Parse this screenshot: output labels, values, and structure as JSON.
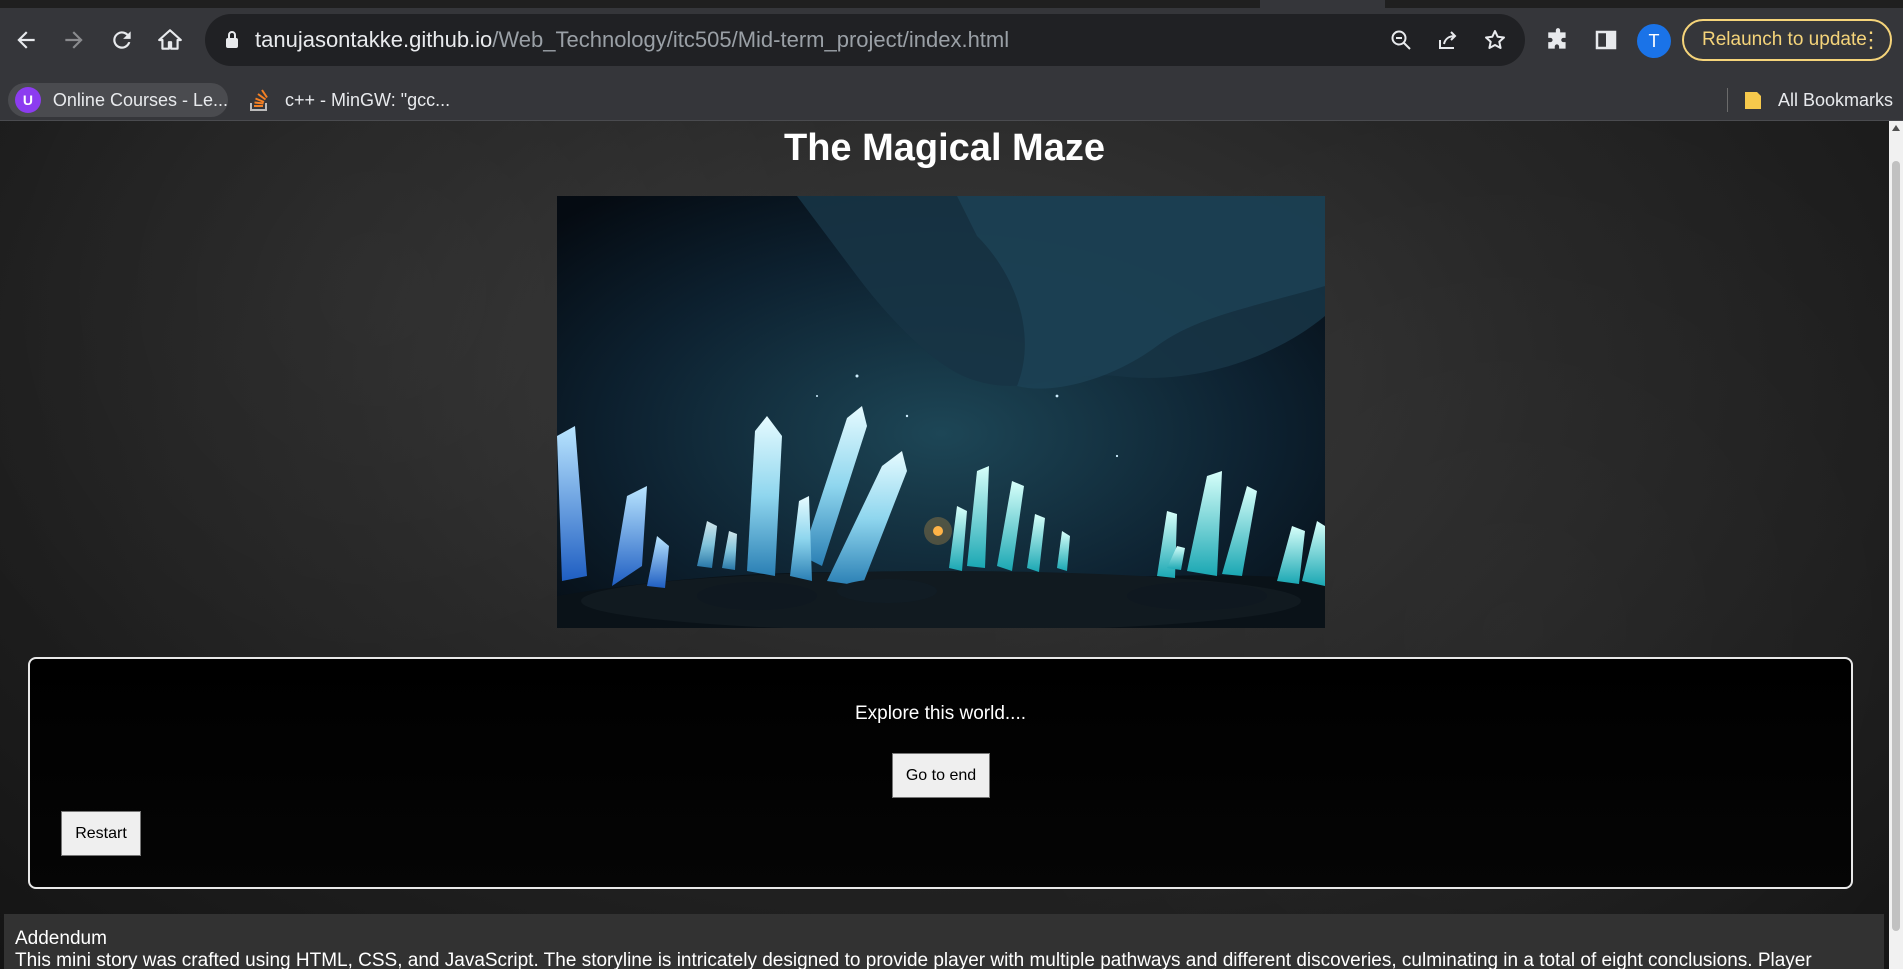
{
  "browser": {
    "url_host": "tanujasontakke.github.io",
    "url_path": "/Web_Technology/itc505/Mid-term_project/index.html",
    "avatar_letter": "T",
    "relaunch_label": "Relaunch to update",
    "icons": [
      "back-icon",
      "forward-icon",
      "reload-icon",
      "home-icon",
      "lock-icon",
      "zoom-icon",
      "share-icon",
      "star-icon",
      "extensions-icon",
      "side-panel-icon",
      "more-icon"
    ]
  },
  "bookmarks": {
    "items": [
      {
        "label": "Online Courses - Le...",
        "icon_color": "#8c3cf0"
      },
      {
        "label": "c++ - MinGW: \"gcc...",
        "icon_color": "#f48024"
      }
    ],
    "all_bookmarks_label": "All Bookmarks"
  },
  "page": {
    "title": "The Magical Maze",
    "story_text": "Explore this world....",
    "go_to_end_label": "Go to end",
    "restart_label": "Restart",
    "addendum_title": "Addendum",
    "addendum_text": "This mini story was crafted using HTML, CSS, and JavaScript. The storyline is intricately designed to provide player with multiple pathways and different discoveries, culminating in a total of eight conclusions. Player"
  }
}
